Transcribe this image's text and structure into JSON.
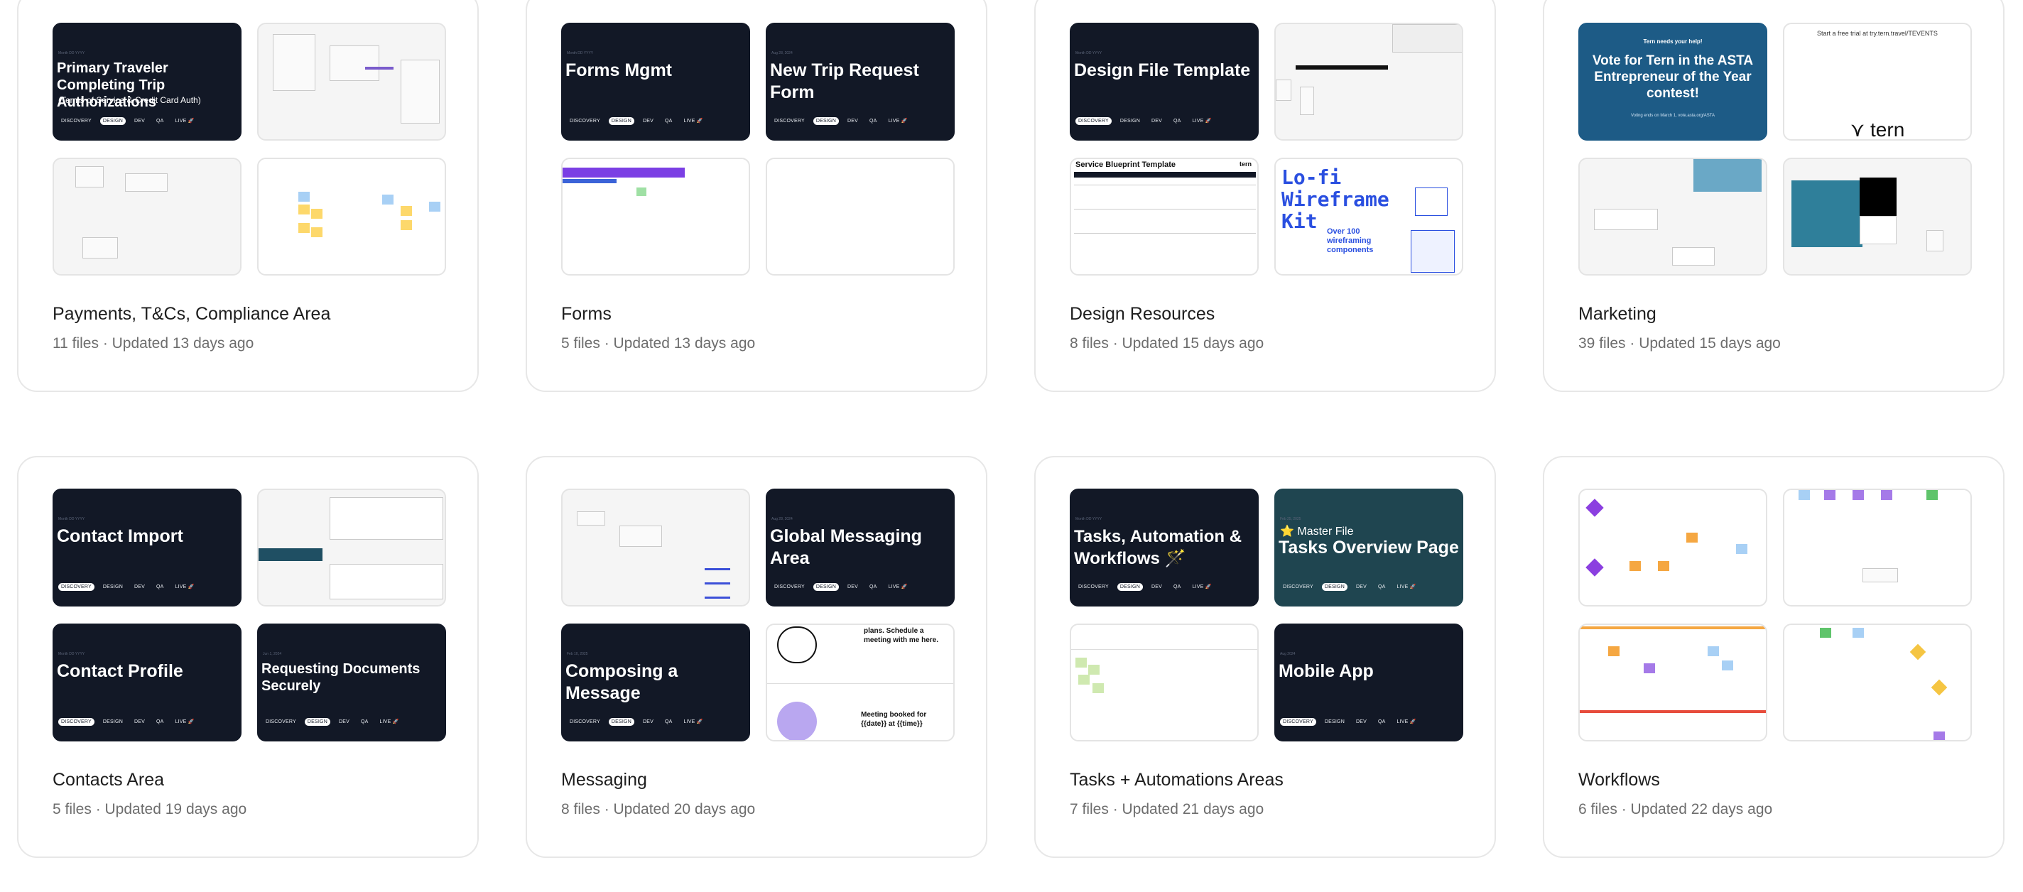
{
  "projects": [
    {
      "title": "Payments, T&Cs, Compliance Area",
      "meta": "11 files · Updated 13 days ago",
      "cover": {
        "date": "Month DD YYYY",
        "title": "Primary Traveler Completing Trip Authorizations",
        "subtitle": "(Terms of Service & Credit Card Auth)",
        "active_tag": "DESIGN"
      }
    },
    {
      "title": "Forms",
      "meta": "5 files · Updated 13 days ago",
      "cover": {
        "date": "Month DD YYYY",
        "title": "Forms Mgmt",
        "active_tag": "DESIGN"
      },
      "cover2": {
        "date": "Aug 28, 2024",
        "title": "New Trip Request Form",
        "active_tag": "DESIGN"
      }
    },
    {
      "title": "Design Resources",
      "meta": "8 files · Updated 15 days ago",
      "cover": {
        "date": "Month DD YYYY",
        "title": "Design File Template",
        "active_tag": "DISCOVERY"
      },
      "blueprint_title": "Service Blueprint Template",
      "blueprint_brand": "tern",
      "wireframe_kit": {
        "line1": "Lo-fi",
        "line2": "Wireframe",
        "line3": "Kit",
        "sub": "Over 100 wireframing components"
      }
    },
    {
      "title": "Marketing",
      "meta": "39 files · Updated 15 days ago",
      "promo": {
        "kicker": "Tern needs your help!",
        "title": "Vote for Tern in the ASTA Entrepreneur of the Year contest!",
        "footer": "Voting ends on March 1, vote.asta.org/ASTA"
      },
      "trial": {
        "text": "Start a free trial at try.tern.travel/TEVENTS",
        "brand": "tern"
      }
    },
    {
      "title": "Contacts Area",
      "meta": "5 files · Updated 19 days ago",
      "cover": {
        "date": "Month DD YYYY",
        "title": "Contact Import",
        "active_tag": "DISCOVERY"
      },
      "cover2": {
        "date": "Month DD YYYY",
        "title": "Contact Profile",
        "active_tag": "DISCOVERY"
      },
      "cover3": {
        "date": "Jun 1, 2024",
        "title": "Requesting Documents Securely",
        "active_tag": "DESIGN"
      }
    },
    {
      "title": "Messaging",
      "meta": "8 files · Updated 20 days ago",
      "cover": {
        "date": "Aug 28, 2024",
        "title": "Global Messaging Area",
        "active_tag": "DESIGN"
      },
      "cover2": {
        "date": "Feb 10, 2025",
        "title": "Composing a Message",
        "active_tag": "DESIGN"
      },
      "illustration": {
        "top": "plans. Schedule a meeting with me here.",
        "bottom": "Meeting booked for {{date}} at {{time}}"
      }
    },
    {
      "title": "Tasks + Automations Areas",
      "meta": "7 files · Updated 21 days ago",
      "cover": {
        "date": "Month DD YYYY",
        "title": "Tasks, Automation & Workflows 🪄",
        "active_tag": "DESIGN"
      },
      "cover2": {
        "date": "Feb 25, 2025",
        "badge": "Master File",
        "title": "Tasks Overview Page",
        "active_tag": "DESIGN"
      },
      "cover3": {
        "date": "Aug 2024",
        "title": "Mobile App",
        "active_tag": "DISCOVERY"
      }
    },
    {
      "title": "Workflows",
      "meta": "6 files · Updated 22 days ago"
    }
  ],
  "tag_labels": [
    "DISCOVERY",
    "DESIGN",
    "DEV",
    "QA",
    "LIVE 🚀"
  ],
  "colors": {
    "cover_dark": "#121826",
    "cover_teal": "#1f4550",
    "promo_blue": "#1d5b86",
    "kit_blue": "#2a4fe0"
  }
}
